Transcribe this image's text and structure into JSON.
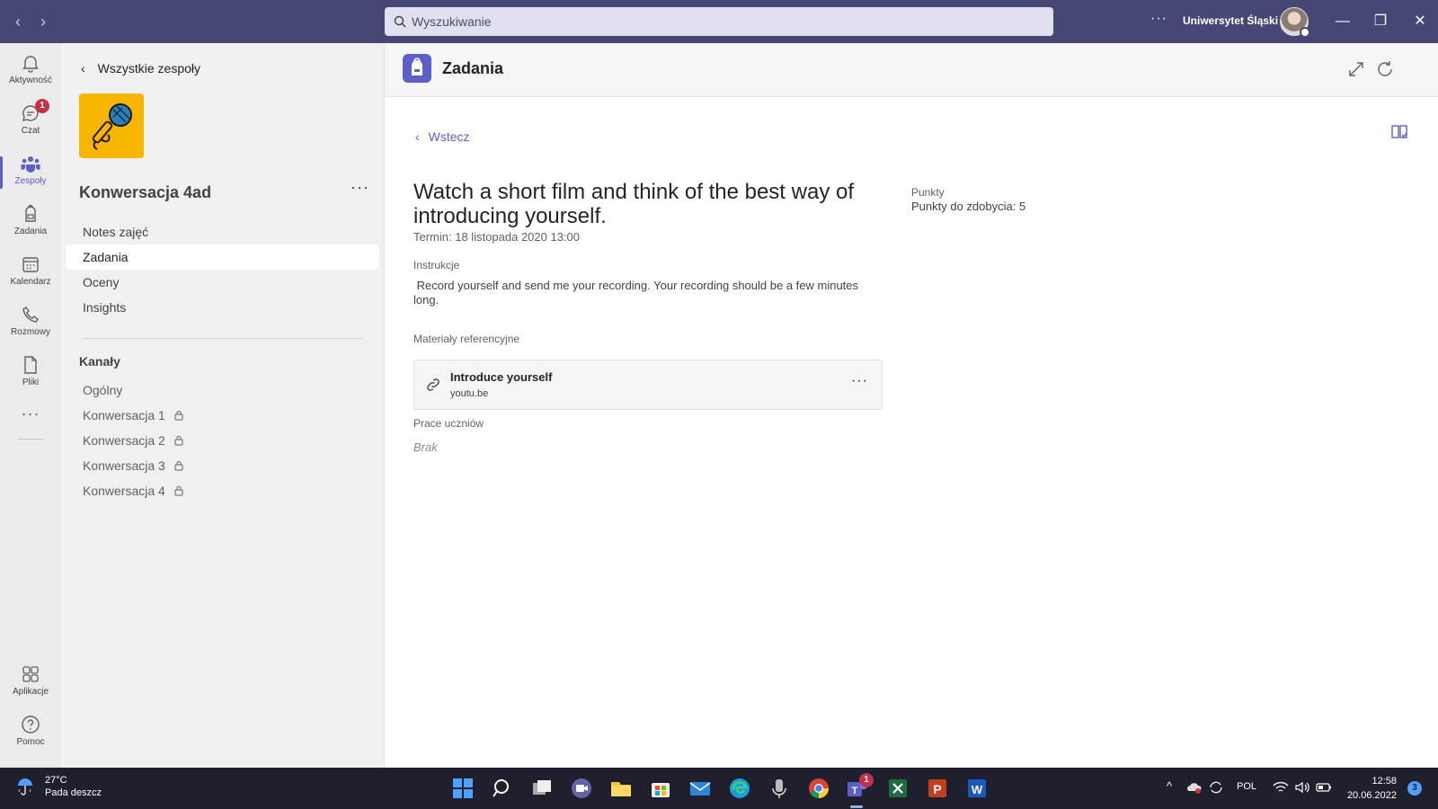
{
  "titlebar": {
    "search_placeholder": "Wyszukiwanie",
    "more": "···",
    "org_name": "Uniwersytet Śląski"
  },
  "rail": {
    "items": [
      {
        "label": "Aktywność",
        "icon": "bell-icon"
      },
      {
        "label": "Czat",
        "icon": "chat-icon",
        "badge": "1"
      },
      {
        "label": "Zespoły",
        "icon": "teams-icon",
        "active": true
      },
      {
        "label": "Zadania",
        "icon": "backpack-icon"
      },
      {
        "label": "Kalendarz",
        "icon": "calendar-icon"
      },
      {
        "label": "Rozmowy",
        "icon": "phone-icon"
      },
      {
        "label": "Pliki",
        "icon": "file-icon"
      },
      {
        "label": "Aplikacje",
        "icon": "apps-icon"
      },
      {
        "label": "Pomoc",
        "icon": "help-icon"
      }
    ],
    "more": "···"
  },
  "team_panel": {
    "back_label": "Wszystkie zespoły",
    "team_name": "Konwersacja 4ad",
    "more": "···",
    "menu": [
      "Notes zajęć",
      "Zadania",
      "Oceny",
      "Insights"
    ],
    "channels_heading": "Kanały",
    "channels": [
      "Ogólny",
      "Konwersacja 1",
      "Konwersacja 2",
      "Konwersacja 3",
      "Konwersacja 4"
    ]
  },
  "main": {
    "app_title": "Zadania",
    "back_label": "Wstecz",
    "assignment_title": "Watch a short film and think of the best way of introducing yourself.",
    "due": "Termin: 18 listopada 2020 13:00",
    "instructions_label": "Instrukcje",
    "instructions_text": " Record yourself and send me your recording. Your recording should be a few minutes long.",
    "reference_label": "Materiały referencyjne",
    "reference": {
      "title": "Introduce yourself",
      "source": "youtu.be",
      "more": "···"
    },
    "student_work_label": "Prace uczniów",
    "student_work_value": "Brak",
    "points_label": "Punkty",
    "points_value": "Punkty do zdobycia: 5"
  },
  "taskbar": {
    "temperature": "27°C",
    "weather": "Pada deszcz",
    "language": "POL",
    "time": "12:58",
    "date": "20.06.2022",
    "notifications": "3",
    "teams_badge": "1"
  },
  "colors": {
    "titlebar": "#464775",
    "accent": "#5b5fc7",
    "rail_bg": "#ebebeb",
    "panel_bg": "#f0f0f0",
    "badge": "#c4314b",
    "team_logo": "#f7b500"
  }
}
